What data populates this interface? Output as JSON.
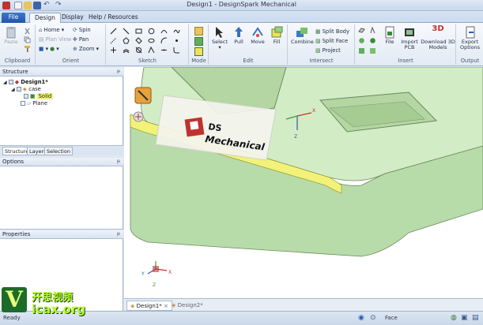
{
  "window": {
    "title": "Design1 - DesignSpark Mechanical"
  },
  "tabs": [
    {
      "label": "File"
    },
    {
      "label": "Design"
    },
    {
      "label": "Display"
    },
    {
      "label": "Help / Resources"
    }
  ],
  "ribbon": {
    "clipboard": {
      "paste": "Paste",
      "group": "Clipboard"
    },
    "orient": {
      "home": "Home",
      "spin": "Spin",
      "plan_view": "Plan View",
      "pan": "Pan",
      "zoom": "Zoom",
      "group": "Orient"
    },
    "sketch": {
      "group": "Sketch"
    },
    "mode": {
      "group": "Mode"
    },
    "edit": {
      "select": "Select",
      "pull": "Pull",
      "move": "Move",
      "fill": "Fill",
      "group": "Edit"
    },
    "intersect": {
      "combine": "Combine",
      "split_body": "Split Body",
      "split_face": "Split Face",
      "project": "Project",
      "group": "Intersect"
    },
    "insert": {
      "file": "File",
      "import_pcb_1": "Import",
      "import_pcb_2": "PCB",
      "download_1": "Download 3D",
      "download_2": "Models",
      "group": "Insert"
    },
    "output": {
      "export_1": "Export",
      "export_2": "Options",
      "group": "Output"
    }
  },
  "structure": {
    "title": "Structure",
    "items": [
      {
        "label": "Design1*"
      },
      {
        "label": "case"
      },
      {
        "label": "Solid"
      },
      {
        "label": "Plane"
      }
    ],
    "subtabs": [
      "Structure",
      "Layers",
      "Selection"
    ]
  },
  "options": {
    "title": "Options"
  },
  "properties": {
    "title": "Properties"
  },
  "viewport": {
    "decal_line1": "DS",
    "decal_line2": "Mechanical",
    "axis_x": "X",
    "axis_y": "Y",
    "axis_z": "Z"
  },
  "doc_tabs": [
    {
      "label": "Design1*"
    },
    {
      "label": "Design2*"
    }
  ],
  "status": {
    "left": "Ready",
    "mode": "Face"
  },
  "watermark": {
    "logo": "V",
    "cn": "开思视频",
    "url": "icax.org"
  },
  "colors": {
    "model_green": "#c8e6bf",
    "accent_blue": "#2a5db0",
    "selection_yellow": "#f2f27a"
  }
}
